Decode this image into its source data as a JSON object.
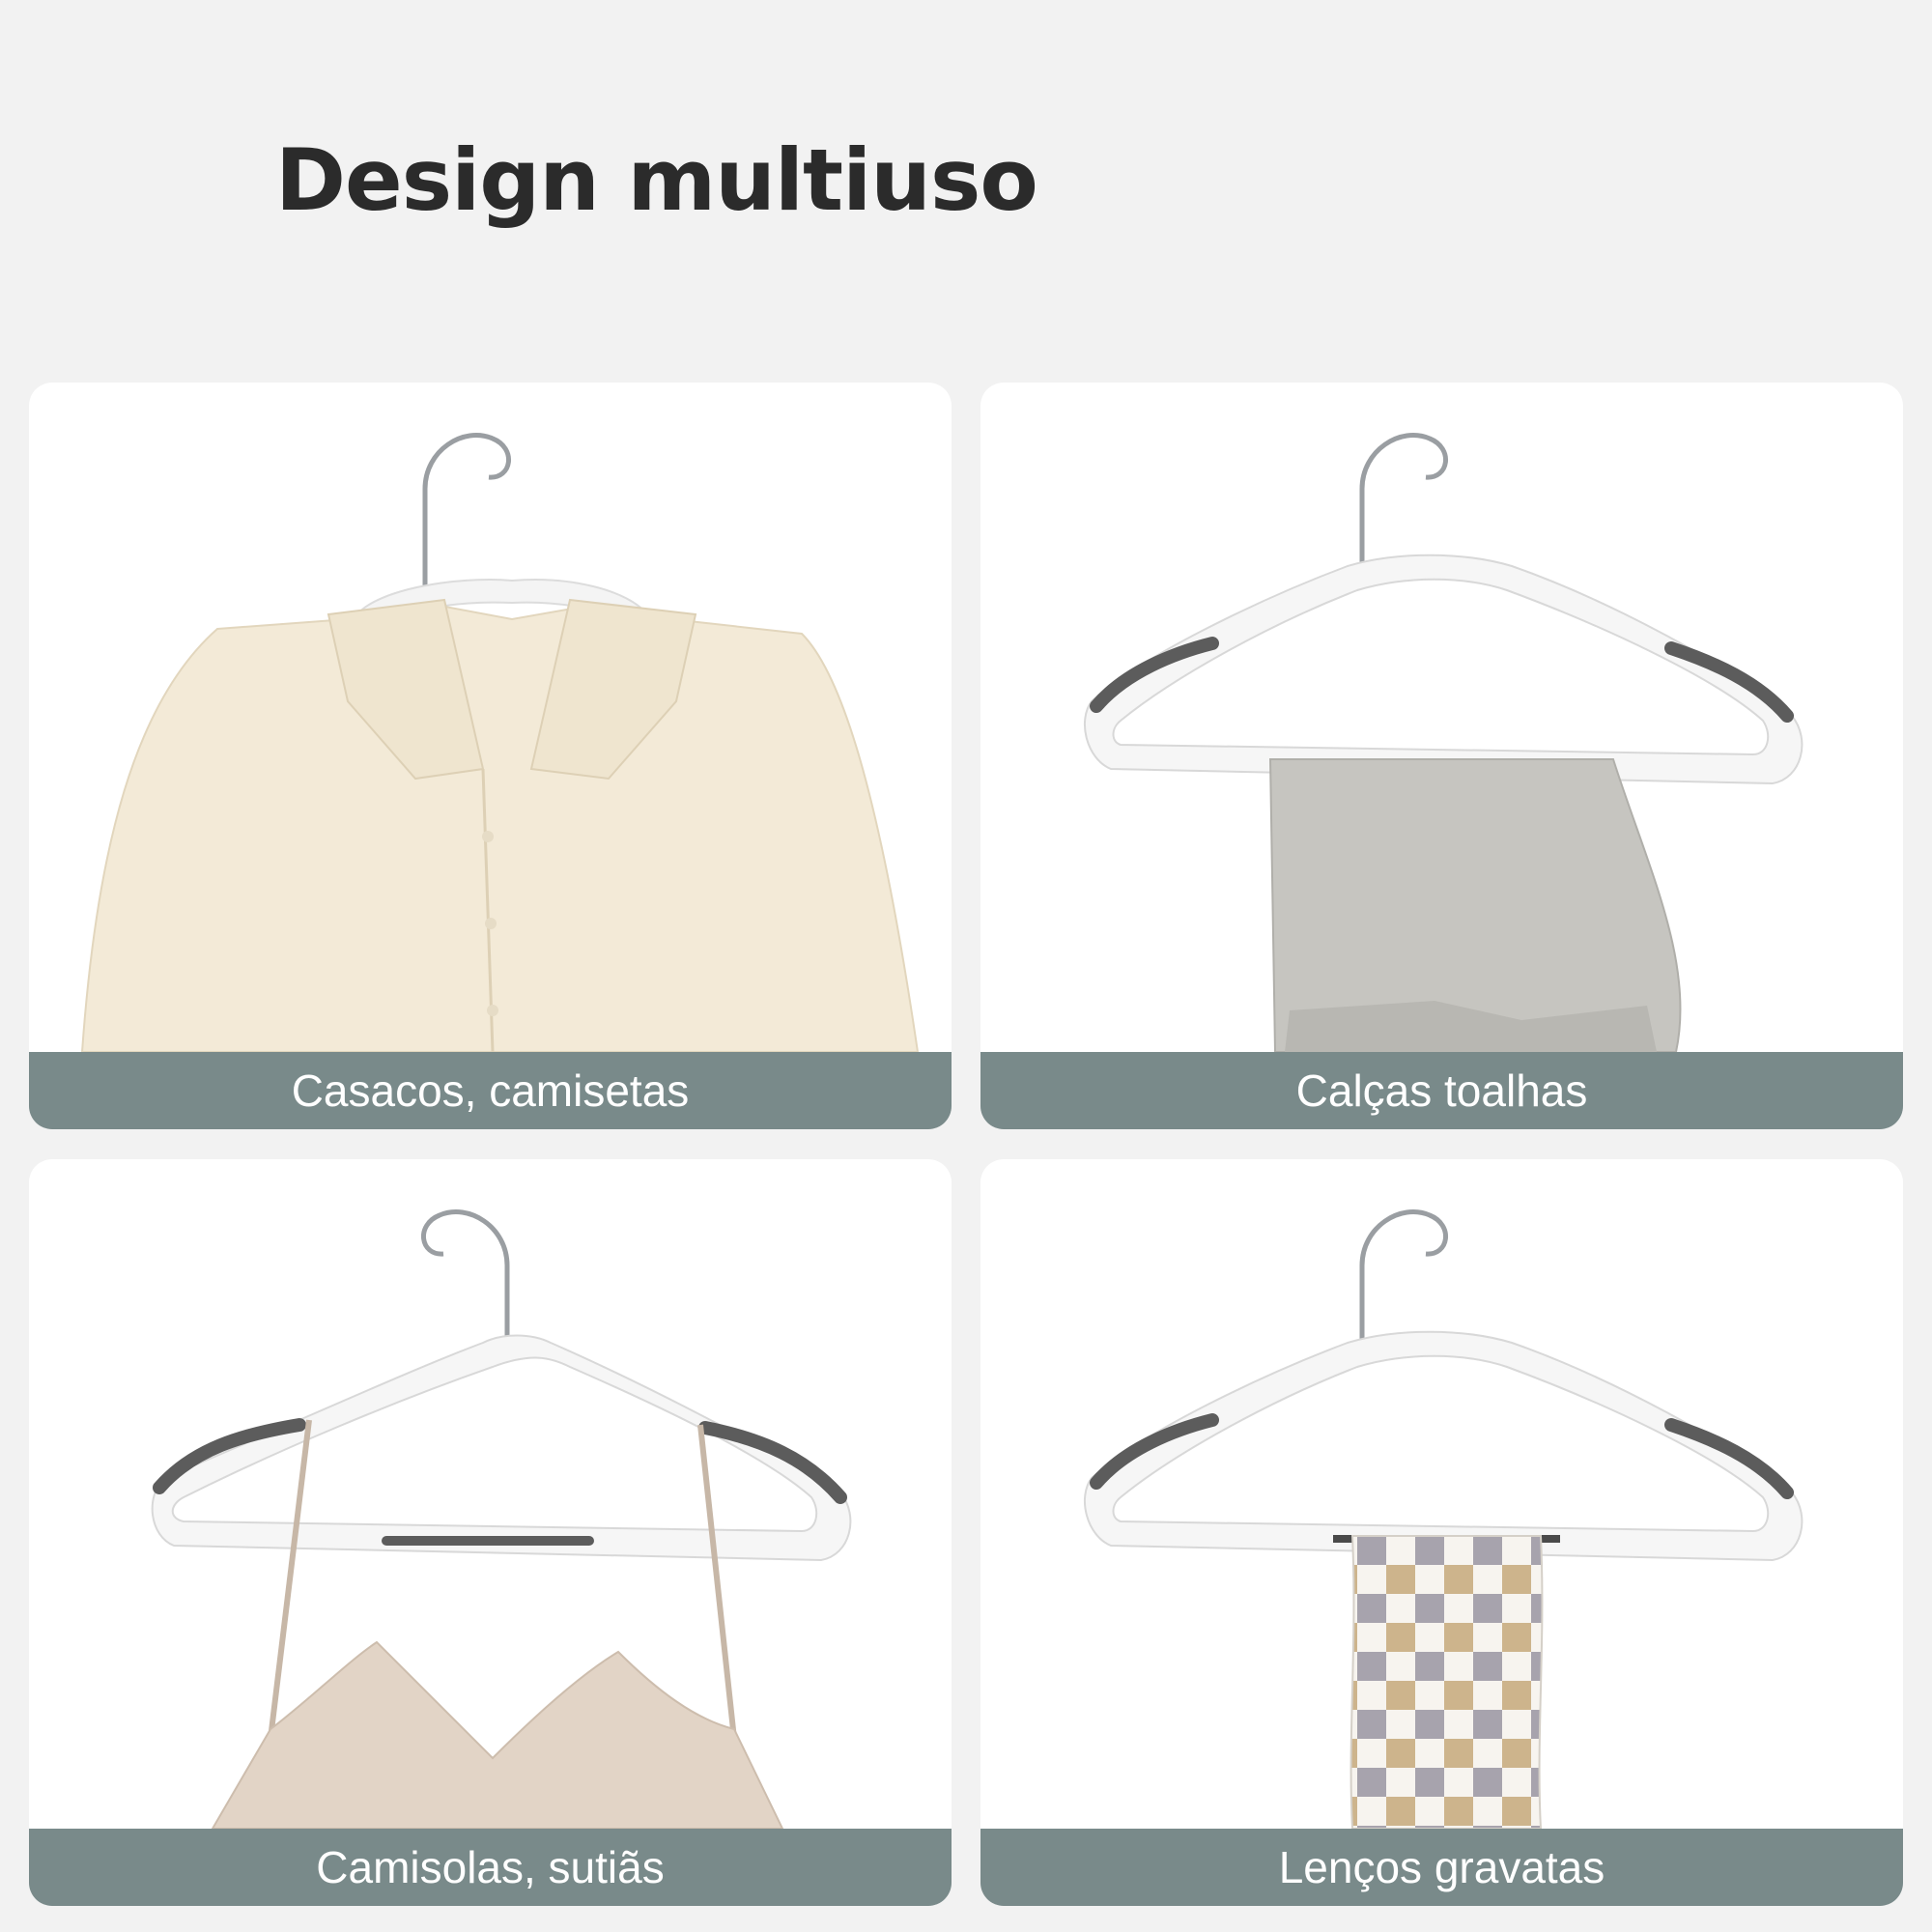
{
  "title": "Design multiuso",
  "colors": {
    "background": "#f2f2f2",
    "caption_bar": "#798a8a",
    "card": "#ffffff"
  },
  "cards": [
    {
      "label": "Casacos, camisetas",
      "garment": "cream-shirt"
    },
    {
      "label": "Calças toalhas",
      "garment": "grey-trousers"
    },
    {
      "label": "Camisolas, sutiãs",
      "garment": "beige-camisole"
    },
    {
      "label": "Lenços gravatas",
      "garment": "checkered-scarf"
    }
  ]
}
